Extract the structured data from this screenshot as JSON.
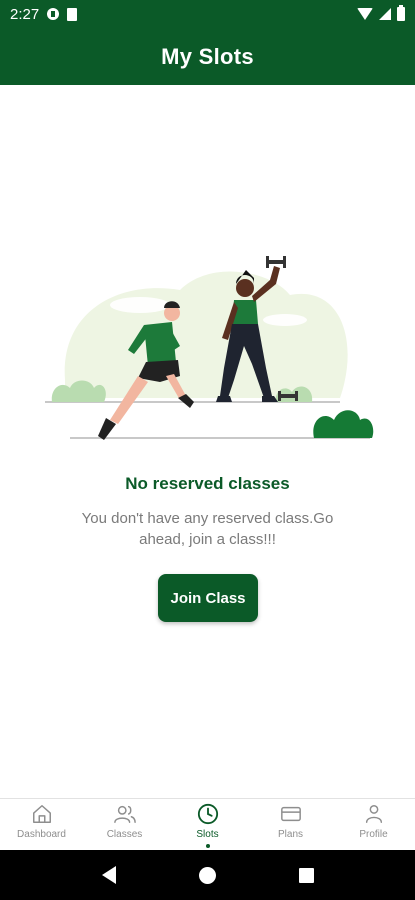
{
  "status_bar": {
    "time": "2:27",
    "icons": [
      "notification-f-icon",
      "sim-card-icon",
      "wifi-icon",
      "signal-icon",
      "battery-icon"
    ]
  },
  "header": {
    "title": "My Slots"
  },
  "empty_state": {
    "illustration": "runner-and-dumbbell-woman",
    "title": "No reserved classes",
    "description": "You don't have any reserved class.Go ahead, join a class!!!",
    "button_label": "Join Class"
  },
  "bottom_nav": {
    "items": [
      {
        "label": "Dashboard",
        "icon": "home-icon",
        "active": false
      },
      {
        "label": "Classes",
        "icon": "users-icon",
        "active": false
      },
      {
        "label": "Slots",
        "icon": "clock-icon",
        "active": true
      },
      {
        "label": "Plans",
        "icon": "card-icon",
        "active": false
      },
      {
        "label": "Profile",
        "icon": "person-icon",
        "active": false
      }
    ]
  },
  "system_nav": [
    "back-icon",
    "home-circle-icon",
    "recents-icon"
  ],
  "colors": {
    "primary": "#0b5a28",
    "text_muted": "#7a7a7a",
    "nav_inactive": "#8e8e8e"
  }
}
